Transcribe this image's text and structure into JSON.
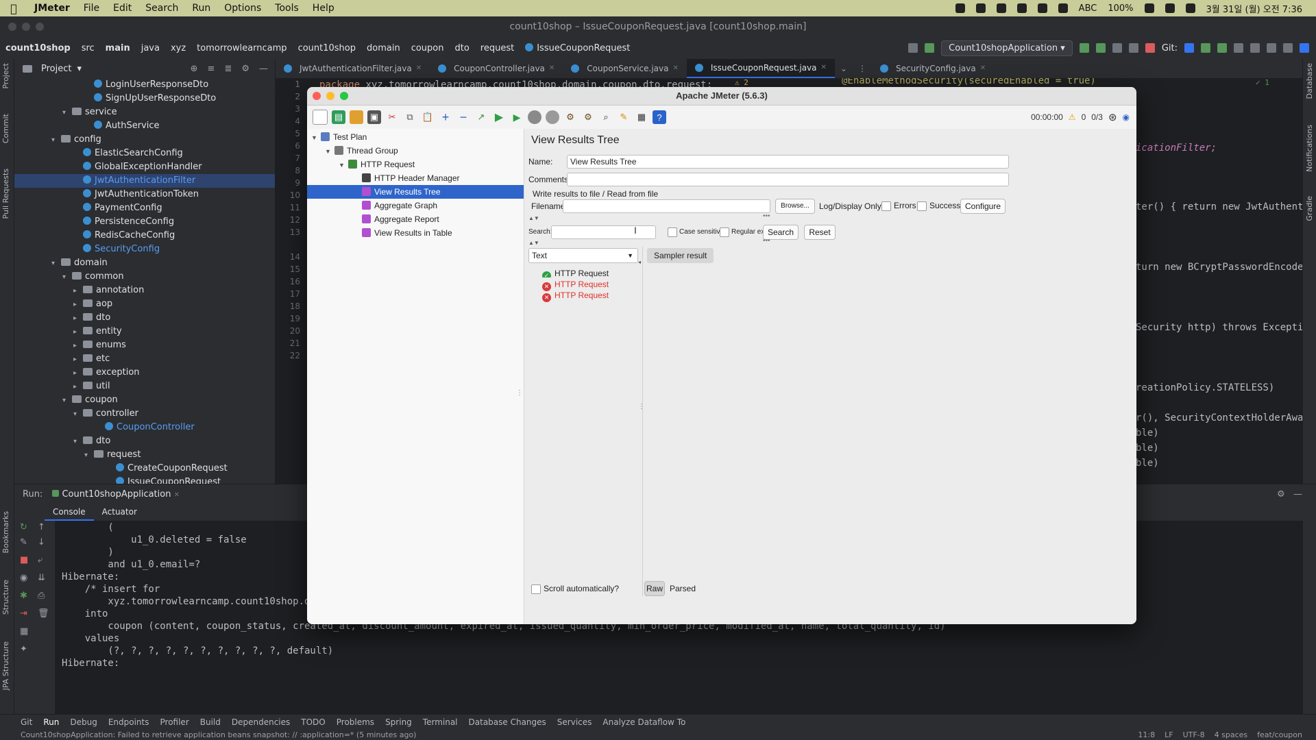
{
  "menubar": {
    "app_name": "JMeter",
    "items": [
      "File",
      "Edit",
      "Search",
      "Run",
      "Options",
      "Tools",
      "Help"
    ],
    "keyboard": "ABC",
    "battery": "100%",
    "datetime": "3월 31일 (월) 오전 7:36"
  },
  "ide": {
    "window_title": "count10shop – IssueCouponRequest.java [count10shop.main]",
    "breadcrumb": [
      "count10shop",
      "src",
      "main",
      "java",
      "xyz",
      "tomorrowlearncamp",
      "count10shop",
      "domain",
      "coupon",
      "dto",
      "request",
      "IssueCouponRequest"
    ],
    "run_config": "Count10shopApplication",
    "git_label": "Git:",
    "project_title": "Project",
    "project_tree": [
      {
        "label": "LoginUserResponseDto",
        "indent": 7,
        "type": "class"
      },
      {
        "label": "SignUpUserResponseDto",
        "indent": 7,
        "type": "class"
      },
      {
        "label": "service",
        "indent": 5,
        "type": "folder",
        "open": true
      },
      {
        "label": "AuthService",
        "indent": 7,
        "type": "class"
      },
      {
        "label": "config",
        "indent": 4,
        "type": "folder",
        "open": true
      },
      {
        "label": "ElasticSearchConfig",
        "indent": 6,
        "type": "class"
      },
      {
        "label": "GlobalExceptionHandler",
        "indent": 6,
        "type": "class"
      },
      {
        "label": "JwtAuthenticationFilter",
        "indent": 6,
        "type": "class",
        "selected": true
      },
      {
        "label": "JwtAuthenticationToken",
        "indent": 6,
        "type": "class"
      },
      {
        "label": "PaymentConfig",
        "indent": 6,
        "type": "class"
      },
      {
        "label": "PersistenceConfig",
        "indent": 6,
        "type": "class"
      },
      {
        "label": "RedisCacheConfig",
        "indent": 6,
        "type": "class"
      },
      {
        "label": "SecurityConfig",
        "indent": 6,
        "type": "class",
        "blue": true
      },
      {
        "label": "domain",
        "indent": 4,
        "type": "folder",
        "open": true
      },
      {
        "label": "common",
        "indent": 5,
        "type": "folder",
        "open": true
      },
      {
        "label": "annotation",
        "indent": 6,
        "type": "folder"
      },
      {
        "label": "aop",
        "indent": 6,
        "type": "folder"
      },
      {
        "label": "dto",
        "indent": 6,
        "type": "folder"
      },
      {
        "label": "entity",
        "indent": 6,
        "type": "folder"
      },
      {
        "label": "enums",
        "indent": 6,
        "type": "folder"
      },
      {
        "label": "etc",
        "indent": 6,
        "type": "folder"
      },
      {
        "label": "exception",
        "indent": 6,
        "type": "folder"
      },
      {
        "label": "util",
        "indent": 6,
        "type": "folder"
      },
      {
        "label": "coupon",
        "indent": 5,
        "type": "folder",
        "open": true
      },
      {
        "label": "controller",
        "indent": 6,
        "type": "folder",
        "open": true
      },
      {
        "label": "CouponController",
        "indent": 8,
        "type": "class",
        "blue": true
      },
      {
        "label": "dto",
        "indent": 6,
        "type": "folder",
        "open": true
      },
      {
        "label": "request",
        "indent": 7,
        "type": "folder",
        "open": true
      },
      {
        "label": "CreateCouponRequest",
        "indent": 9,
        "type": "class"
      },
      {
        "label": "IssueCouponRequest",
        "indent": 9,
        "type": "class"
      }
    ],
    "editor_tabs": [
      {
        "label": "JwtAuthenticationFilter.java",
        "active": false
      },
      {
        "label": "CouponController.java",
        "active": false
      },
      {
        "label": "CouponService.java",
        "active": false
      },
      {
        "label": "IssueCouponRequest.java",
        "active": true
      },
      {
        "label": "SecurityConfig.java",
        "active": false
      }
    ],
    "line_numbers": [
      "1",
      "2",
      "3",
      "4",
      "5",
      "6",
      "7",
      "8",
      "9",
      "10",
      "11",
      "12",
      "13",
      "14",
      "15",
      "16",
      "17",
      "18",
      "19",
      "20",
      "21",
      "22"
    ],
    "code_line1_kw": "package",
    "code_line1_rest": " xyz.tomorrowlearncamp.count10shop.domain.coupon.dto.request;",
    "code_right": [
      "@EnableMethodSecurity(securedEnabled = true)",
      "icationFilter;",
      "ter() { return new JwtAuthentic",
      "turn new BCryptPasswordEncoder(",
      "Security http) throws Exception",
      "reationPolicy.STATELESS)",
      "r(), SecurityContextHolderAware",
      "ble)",
      "ble)",
      "ble)"
    ],
    "warnings": "2",
    "checks": "1",
    "run_label": "Run:",
    "run_app": "Count10shopApplication",
    "run_tabs": [
      "Console",
      "Actuator"
    ],
    "console_lines": [
      "        (",
      "            u1_0.deleted = false",
      "        )",
      "        and u1_0.email=?",
      "Hibernate:",
      "    /* insert for",
      "        xyz.tomorrowlearncamp.count10shop.domain.coupon.entity.Coupon */insert",
      "    into",
      "        coupon (content, coupon_status, created_at, discount_amount, expired_at, issued_quantity, min_order_price, modified_at, name, total_quantity, id)",
      "    values",
      "        (?, ?, ?, ?, ?, ?, ?, ?, ?, ?, default)",
      "Hibernate:"
    ],
    "bottom_tools": [
      "Git",
      "Run",
      "Debug",
      "Endpoints",
      "Profiler",
      "Build",
      "Dependencies",
      "TODO",
      "Problems",
      "Spring",
      "Terminal",
      "Database Changes",
      "Services",
      "Analyze Dataflow To"
    ],
    "status_message": "Count10shopApplication: Failed to retrieve application beans snapshot: // :application=* (5 minutes ago)",
    "status_right": [
      "11:8",
      "LF",
      "UTF-8",
      "4 spaces",
      "feat/coupon"
    ],
    "left_strip_labels": [
      "Project",
      "Commit",
      "Pull Requests",
      "Bookmarks",
      "Structure",
      "JPA Structure"
    ],
    "right_strip_labels": [
      "Database",
      "Notifications",
      "Gradle"
    ]
  },
  "jmeter": {
    "title": "Apache JMeter (5.6.3)",
    "timer": "00:00:00",
    "warn_count": "0",
    "threads": "0/3",
    "tree": [
      {
        "label": "Test Plan",
        "indent": 0,
        "icon": "test-plan"
      },
      {
        "label": "Thread Group",
        "indent": 1,
        "icon": "thread-group"
      },
      {
        "label": "HTTP Request",
        "indent": 2,
        "icon": "http-request"
      },
      {
        "label": "HTTP Header Manager",
        "indent": 3,
        "icon": "header-manager"
      },
      {
        "label": "View Results Tree",
        "indent": 3,
        "icon": "listener",
        "selected": true
      },
      {
        "label": "Aggregate Graph",
        "indent": 3,
        "icon": "listener"
      },
      {
        "label": "Aggregate Report",
        "indent": 3,
        "icon": "listener"
      },
      {
        "label": "View Results in Table",
        "indent": 3,
        "icon": "listener"
      }
    ],
    "panel_title": "View Results Tree",
    "name_label": "Name:",
    "name_value": "View Results Tree",
    "comments_label": "Comments:",
    "comments_value": "",
    "write_results_label": "Write results to file / Read from file",
    "filename_label": "Filename",
    "filename_value": "",
    "browse_label": "Browse...",
    "log_display_label": "Log/Display Only:",
    "errors_label": "Errors",
    "successes_label": "Successes",
    "configure_label": "Configure",
    "search_label": "Search:",
    "search_value": "",
    "case_sensitive_label": "Case sensitive",
    "regex_label": "Regular exp.",
    "search_button": "Search",
    "reset_button": "Reset",
    "renderer_selected": "Text",
    "results": [
      {
        "label": "HTTP Request",
        "status": "success"
      },
      {
        "label": "HTTP Request",
        "status": "error"
      },
      {
        "label": "HTTP Request",
        "status": "error"
      }
    ],
    "sampler_tab": "Sampler result",
    "scroll_auto_label": "Scroll automatically?",
    "raw_label": "Raw",
    "parsed_label": "Parsed"
  }
}
